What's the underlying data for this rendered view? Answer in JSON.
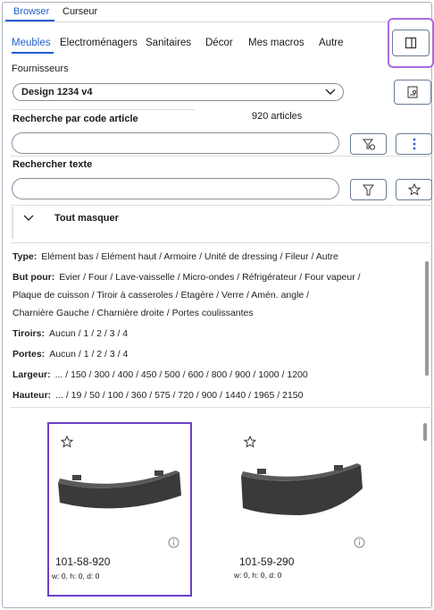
{
  "top_tabs": [
    "Browser",
    "Curseur"
  ],
  "categories": [
    "Meubles",
    "Electroménagers",
    "Sanitaires",
    "Décor",
    "Mes macros",
    "Autre"
  ],
  "suppliers": {
    "label": "Fournisseurs",
    "selected": "Design 1234 v4"
  },
  "code_search": {
    "label": "Recherche par code article",
    "count": "920 articles",
    "value": ""
  },
  "text_search": {
    "label": "Rechercher texte",
    "value": ""
  },
  "collapse_label": "Tout masquer",
  "filters": [
    {
      "key": "Type:",
      "values": "Elément bas / Elément haut / Armoire / Unité de dressing / Fileur / Autre"
    },
    {
      "key": "But pour:",
      "values": "Evier / Four / Lave-vaisselle / Micro-ondes / Réfrigérateur / Four vapeur /"
    },
    {
      "key": "",
      "values": "Plaque de cuisson / Tiroir à casseroles / Etagère / Verre / Amén. angle /"
    },
    {
      "key": "",
      "values": "Charnière Gauche / Charnière droite / Portes coulissantes"
    },
    {
      "key": "Tiroirs:",
      "values": "Aucun / 1 / 2 / 3 / 4"
    },
    {
      "key": "Portes:",
      "values": "Aucun / 1 / 2 / 3 / 4"
    },
    {
      "key": "Largeur:",
      "values": "... / 150 / 300 / 400 / 450 / 500 / 600 / 800 / 900 / 1000 / 1200"
    },
    {
      "key": "Hauteur:",
      "values": "... / 19 / 50 / 100 / 360 / 575 / 720 / 900 / 1440 / 1965 / 2150"
    }
  ],
  "products": [
    {
      "code": "101-58-920",
      "dims": "w: 0, h: 0, d: 0",
      "selected": true
    },
    {
      "code": "101-59-290",
      "dims": "w: 0, h: 0, d: 0",
      "selected": false
    }
  ]
}
